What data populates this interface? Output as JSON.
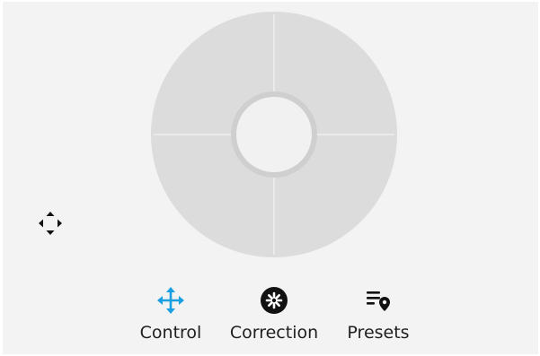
{
  "accent_color": "#1a9fe0",
  "joystick": {
    "pad_icon": "circular-joystick-pad",
    "knob_icon": "joystick-knob"
  },
  "recenter": {
    "icon": "four-arrows-recenter-icon"
  },
  "tabs": [
    {
      "label": "Control",
      "icon": "move-arrows-icon",
      "active": true
    },
    {
      "label": "Correction",
      "icon": "aperture-icon",
      "active": false
    },
    {
      "label": "Presets",
      "icon": "list-pin-icon",
      "active": false
    }
  ]
}
